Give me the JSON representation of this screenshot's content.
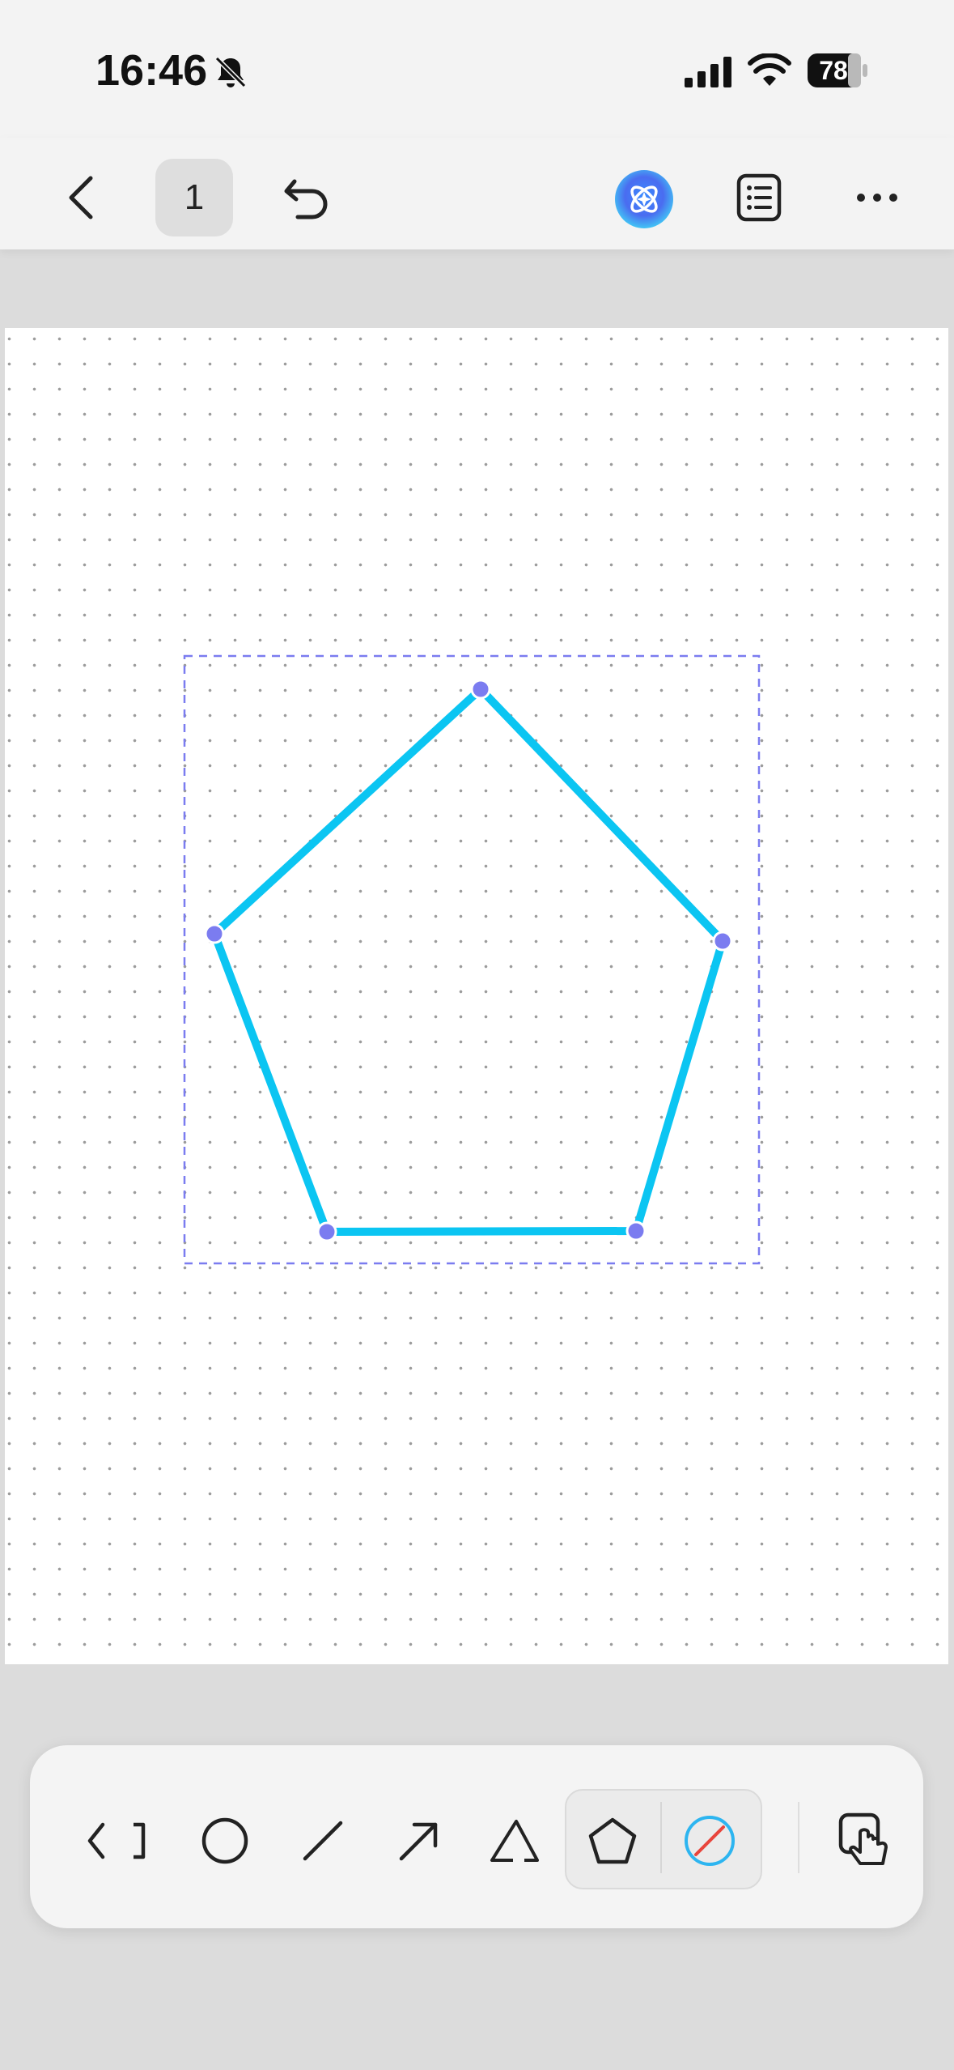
{
  "status_bar": {
    "time": "16:46",
    "silent_icon": "bell-slash-icon",
    "signal_icon": "cellular-signal-icon",
    "wifi_icon": "wifi-icon",
    "battery_level": "78"
  },
  "top_toolbar": {
    "back_icon": "chevron-left-icon",
    "page_number": "1",
    "undo_icon": "undo-icon",
    "ai_assistant_icon": "ai-sparkle-icon",
    "outline_icon": "list-icon",
    "more_icon": "ellipsis-icon"
  },
  "canvas": {
    "background": "dot-grid",
    "shape": {
      "type": "pentagon",
      "selected": true,
      "stroke_color": "#0bc5f2",
      "vertex_handle_color": "#7b7cf0",
      "selection_box_color": "#7b7cf0",
      "vertex_count": 5
    }
  },
  "bottom_toolbar": {
    "tools": [
      {
        "name": "collapse",
        "icon": "collapse-toolbar-icon"
      },
      {
        "name": "circle",
        "icon": "circle-icon"
      },
      {
        "name": "line",
        "icon": "line-icon"
      },
      {
        "name": "arrow",
        "icon": "arrow-icon"
      },
      {
        "name": "triangle",
        "icon": "triangle-icon"
      },
      {
        "name": "pentagon",
        "icon": "pentagon-icon",
        "selected": true
      },
      {
        "name": "fill-color",
        "icon": "no-fill-color-icon"
      },
      {
        "name": "touch-mode",
        "icon": "touch-hand-icon"
      }
    ],
    "accent_color": "#2db5f0"
  }
}
